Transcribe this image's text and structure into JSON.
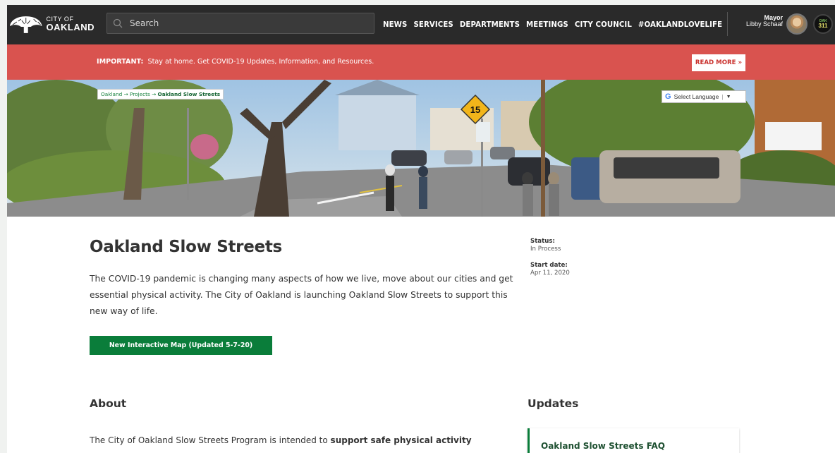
{
  "header": {
    "logo_line1": "CITY OF",
    "logo_line2": "OAKLAND",
    "search_placeholder": "Search",
    "nav": [
      "NEWS",
      "SERVICES",
      "DEPARTMENTS",
      "MEETINGS",
      "CITY COUNCIL",
      "#OAKLANDLOVELIFE"
    ],
    "mayor_title": "Mayor",
    "mayor_name": "Libby Schaaf",
    "badge_311_top": "OAK",
    "badge_311_bottom": "311"
  },
  "alert": {
    "label": "IMPORTANT:",
    "text": "Stay at home. Get COVID-19 Updates, Information, and Resources.",
    "button": "READ MORE »"
  },
  "hero": {
    "breadcrumb": [
      "Oakland",
      "Projects",
      "Oakland Slow Streets"
    ],
    "breadcrumb_sep": "→",
    "language_label": "Select Language",
    "language_arrow": "▼",
    "speed_sign": "15"
  },
  "main": {
    "title": "Oakland Slow Streets",
    "intro": "The COVID-19 pandemic is changing many aspects of how we live, move about our cities and get essential physical activity. The City of Oakland is launching Oakland Slow Streets to support this new way of life.",
    "map_button": "New Interactive Map (Updated 5-7-20)"
  },
  "meta": {
    "status_label": "Status:",
    "status_value": "In Process",
    "start_label": "Start date:",
    "start_value": "Apr 11, 2020"
  },
  "about": {
    "heading": "About",
    "text_start": "The City of Oakland Slow Streets Program is intended to ",
    "text_bold": "support safe physical activity"
  },
  "updates": {
    "heading": "Updates",
    "first_item": "Oakland Slow Streets FAQ"
  },
  "colors": {
    "header_bg": "#2a2a2a",
    "alert_bg": "#d9534f",
    "accent_green": "#0a7d3a"
  }
}
